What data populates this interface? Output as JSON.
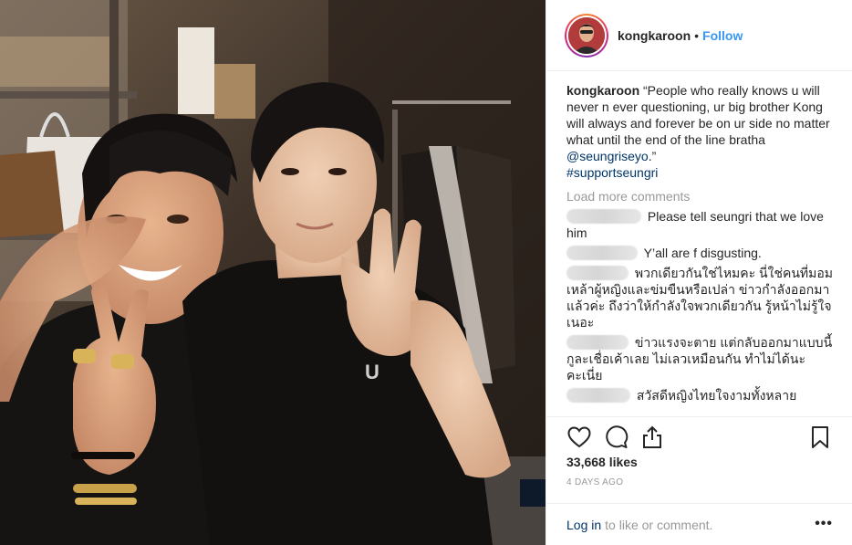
{
  "header": {
    "username": "kongkaroon",
    "separator": "•",
    "follow_label": "Follow"
  },
  "caption": {
    "username": "kongkaroon",
    "text_before_mention": "“People who really knows u will never n ever questioning, ur big brother Kong will always and forever be on ur side no matter what until the end of the line bratha ",
    "mention": "@seungriseyo",
    "text_after_mention": ".”",
    "hashtag": "#supportseungri"
  },
  "load_more_label": "Load more comments",
  "comments": [
    {
      "text": "Please tell seungri that we love him"
    },
    {
      "text": "Y’all are f disgusting."
    },
    {
      "text": "พวกเดียวกันใช่ไหมคะ นี่ใช่คนที่มอมเหล้าผู้หญิงและข่มขืนหรือเปล่า ข่าวกำลังออกมาแล้วค่ะ ถึงว่าให้กำลังใจพวกเดียวกัน รู้หน้าไม่รู้ใจเนอะ"
    },
    {
      "text": "ข่าวแรงจะตาย แต่กลับออกมาแบบนี้ กูละเชื่อเค้าเลย ไม่เลวเหมือนกัน ทำไม่ได้นะคะเนี่ย"
    },
    {
      "text": "สวัสดีหญิงไทยใจงามทั้งหลาย"
    }
  ],
  "icons": {
    "like": "heart-icon",
    "comment": "comment-icon",
    "share": "share-icon",
    "save": "bookmark-icon",
    "more": "more-options-icon"
  },
  "likes_text": "33,668 likes",
  "time_text": "4 DAYS AGO",
  "add_comment": {
    "login_label": "Log in",
    "rest_label": "to like or comment.",
    "more_label": "•••"
  },
  "photo": {
    "shirt_logo": "U"
  },
  "colors": {
    "link": "#003569",
    "follow": "#3897f0",
    "muted": "#999999",
    "border": "#efefef"
  }
}
